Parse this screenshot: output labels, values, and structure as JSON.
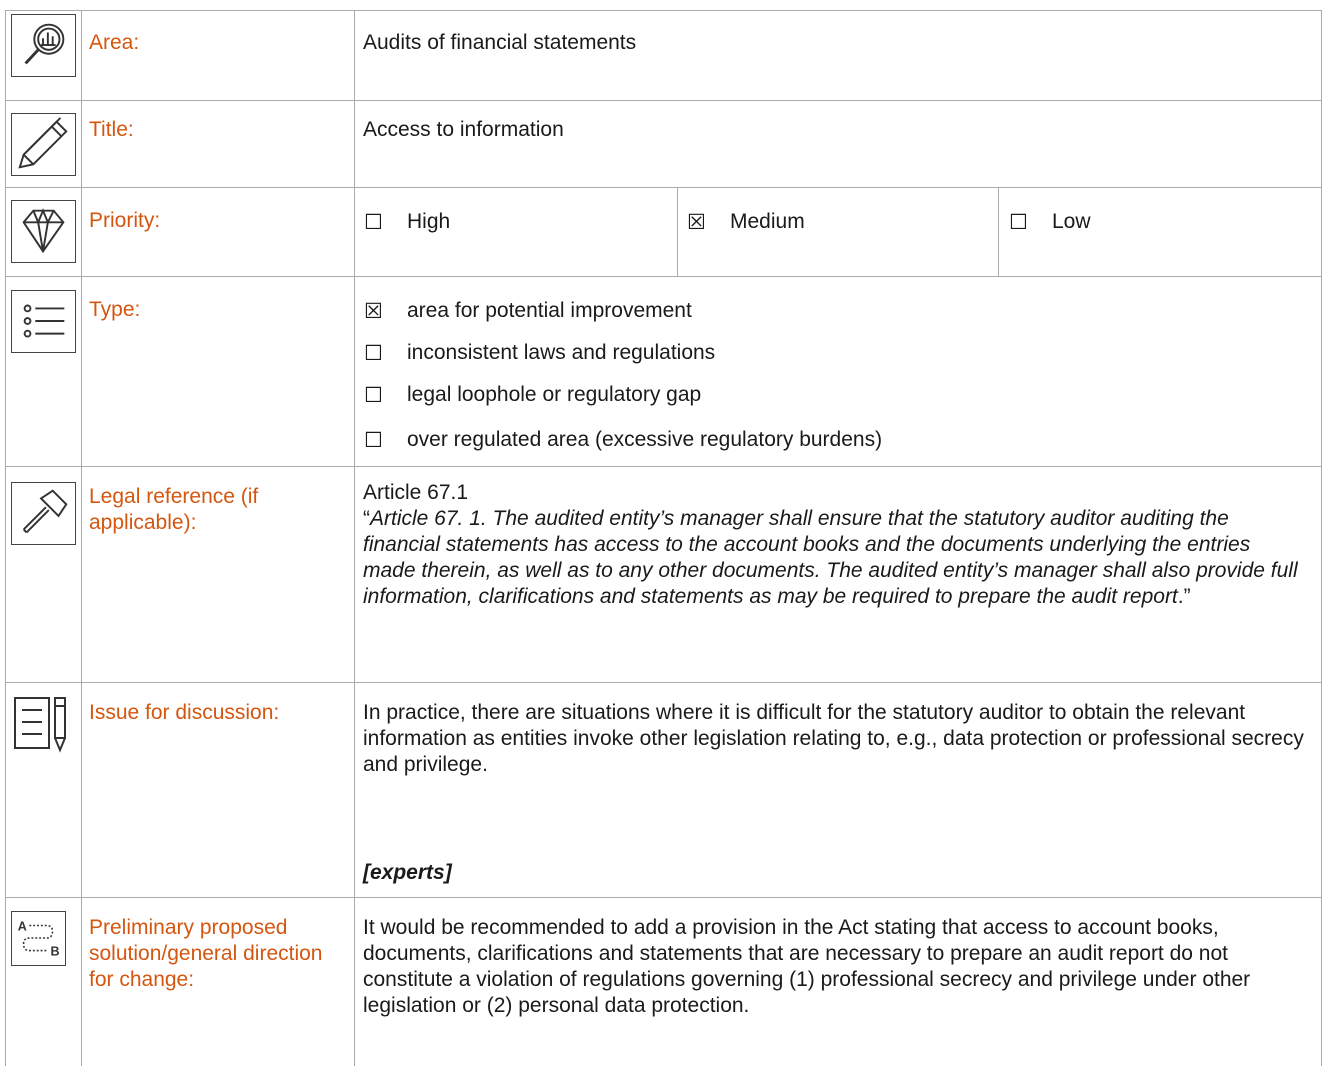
{
  "rows": {
    "area": {
      "label": "Area:",
      "value": "Audits of financial statements",
      "icon": "magnifier-chart-icon"
    },
    "title": {
      "label": "Title:",
      "value": "Access to information",
      "icon": "pencil-icon"
    },
    "priority": {
      "label": "Priority:",
      "icon": "diamond-icon",
      "options": [
        {
          "box": "☐",
          "text": "High"
        },
        {
          "box": "☒",
          "text": "Medium"
        },
        {
          "box": "☐",
          "text": "Low"
        }
      ]
    },
    "type": {
      "label": "Type:",
      "icon": "list-icon",
      "options": [
        {
          "box": "☒",
          "text": "area for potential improvement"
        },
        {
          "box": "☐",
          "text": "inconsistent laws and regulations"
        },
        {
          "box": "☐",
          "text": "legal loophole or regulatory gap"
        },
        {
          "box": "☐",
          "text": "over regulated area (excessive regulatory burdens)"
        }
      ]
    },
    "legal": {
      "label": "Legal reference (if applicable):",
      "icon": "gavel-icon",
      "article": "Article 67.1",
      "quote_open": "“",
      "quote_body": "Article 67. 1. The audited entity’s manager shall ensure that the statutory auditor auditing the financial statements has access to the account books and the documents underlying the entries made therein, as well as to any other documents. The audited entity’s manager shall also provide full information, clarifications and statements as may be required to prepare the audit report",
      "quote_close": ".”"
    },
    "issue": {
      "label": "Issue for discussion:",
      "icon": "notepad-pen-icon",
      "text": "In practice, there are situations where it is difficult for the statutory auditor to obtain the relevant information as entities invoke other legislation relating to, e.g., data protection or professional secrecy and privilege.",
      "experts": "[experts]"
    },
    "solution": {
      "label": "Preliminary proposed solution/general direction for change:",
      "icon": "route-a-b-icon",
      "text": "It would be recommended to add a provision in the Act stating that access to account books, documents, clarifications and statements that are necessary to prepare an audit report do not constitute a violation of regulations governing (1) professional secrecy and privilege under other legislation or (2) personal data protection."
    }
  }
}
